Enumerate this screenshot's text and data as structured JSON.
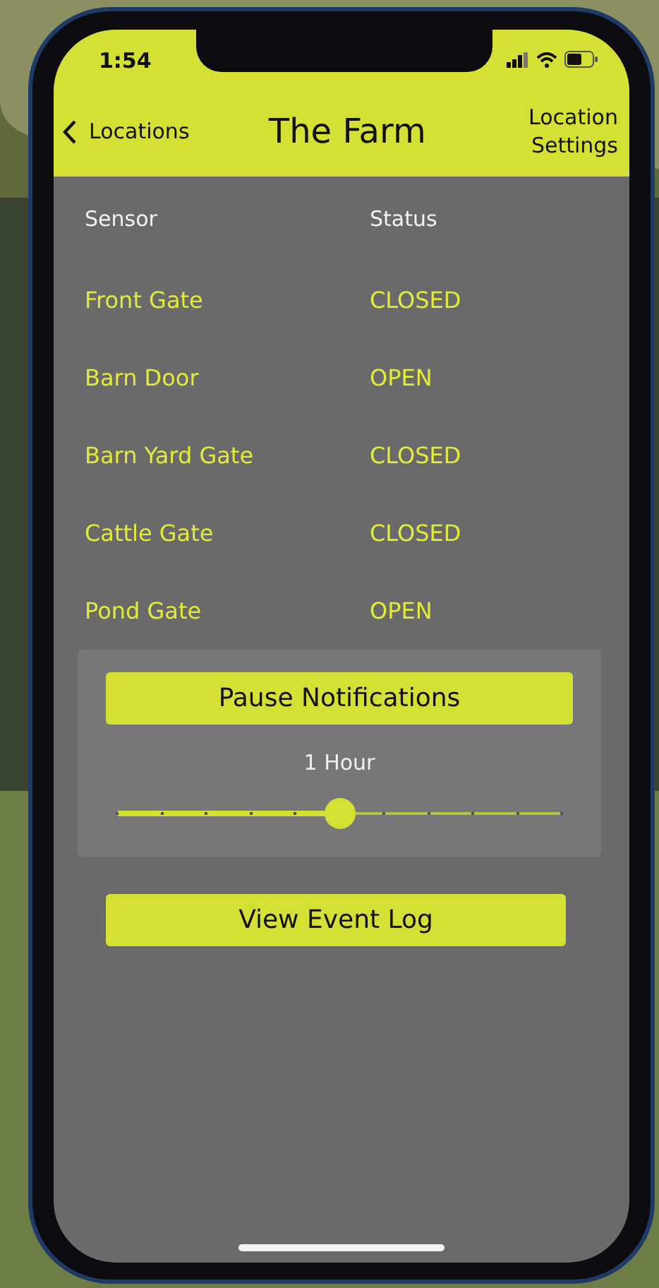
{
  "status_bar": {
    "time": "1:54"
  },
  "nav": {
    "back_label": "Locations",
    "title": "The Farm",
    "action_label": "Location Settings"
  },
  "table": {
    "columns": [
      "Sensor",
      "Status"
    ],
    "rows": [
      {
        "sensor": "Front Gate",
        "status": "CLOSED"
      },
      {
        "sensor": "Barn Door",
        "status": "OPEN"
      },
      {
        "sensor": "Barn Yard Gate",
        "status": "CLOSED"
      },
      {
        "sensor": "Cattle Gate",
        "status": "CLOSED"
      },
      {
        "sensor": "Pond Gate",
        "status": "OPEN"
      }
    ]
  },
  "pause": {
    "button": "Pause Notifications",
    "reading": "1 Hour",
    "level": 0.5
  },
  "event_log_button": "View Event Log"
}
